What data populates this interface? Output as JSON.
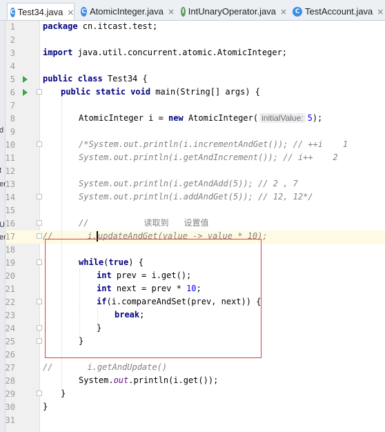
{
  "tabs": [
    {
      "label": "Test34.java",
      "icon": "class-icon",
      "icon_letter": "C",
      "color": "#3d8ee6",
      "active": true
    },
    {
      "label": "AtomicInteger.java",
      "icon": "class-icon",
      "icon_letter": "C",
      "color": "#3d8ee6",
      "active": false
    },
    {
      "label": "IntUnaryOperator.java",
      "icon": "interface-icon",
      "icon_letter": "I",
      "color": "#5aa05a",
      "active": false
    },
    {
      "label": "TestAccount.java",
      "icon": "class-icon",
      "icon_letter": "C",
      "color": "#3d8ee6",
      "active": false
    }
  ],
  "close_glyph": "×",
  "left_strip_chars": [
    "d",
    "t",
    "er",
    "U",
    "er"
  ],
  "line_numbers": [
    "1",
    "2",
    "3",
    "4",
    "5",
    "6",
    "7",
    "8",
    "9",
    "10",
    "11",
    "12",
    "13",
    "14",
    "15",
    "16",
    "17",
    "18",
    "19",
    "20",
    "21",
    "22",
    "23",
    "24",
    "25",
    "26",
    "27",
    "28",
    "29",
    "30",
    "31"
  ],
  "highlighted_line": 17,
  "run_gutter_lines": [
    5,
    6
  ],
  "code": {
    "l1_kw": "package",
    "l1_rest": " cn.itcast.test;",
    "l3_kw": "import",
    "l3_rest": " java.util.concurrent.atomic.AtomicInteger;",
    "l5_kw": "public class",
    "l5_rest": " Test34 {",
    "l6_kw": "public static void",
    "l6_rest": " main(String[] args) {",
    "l8_a": "AtomicInteger i = ",
    "l8_kw": "new",
    "l8_b": " AtomicInteger(",
    "l8_hint": "initialValue:",
    "l8_num": "5",
    "l8_c": ");",
    "l10": "/*System.out.println(i.incrementAndGet()); // ++i    1",
    "l11": "System.out.println(i.getAndIncrement()); // i++    2",
    "l13": "System.out.println(i.getAndAdd(5)); // 2 , 7",
    "l14": "System.out.println(i.addAndGet(5)); // 12, 12*/",
    "l16_a": "//",
    "l16_b": "读取到",
    "l16_c": "设置值",
    "l17_a": "//",
    "l17_b": "i.",
    "l17_c": "updateAndGet(value -> value * 10);",
    "l19_kw": "while",
    "l19_a": "(",
    "l19_kw2": "true",
    "l19_b": ") {",
    "l20_kw": "int",
    "l20_rest": " prev = i.get();",
    "l21_kw": "int",
    "l21_rest": " next = prev * ",
    "l21_num": "10",
    "l21_end": ";",
    "l22_kw": "if",
    "l22_rest": "(i.compareAndSet(prev, next)) {",
    "l23_kw": "break",
    "l23_rest": ";",
    "l24": "}",
    "l25": "}",
    "l27_a": "//",
    "l27_b": "i.getAndUpdate()",
    "l28_a": "System.",
    "l28_st": "out",
    "l28_b": ".println(i.get());",
    "l29": "}",
    "l30": "}"
  }
}
